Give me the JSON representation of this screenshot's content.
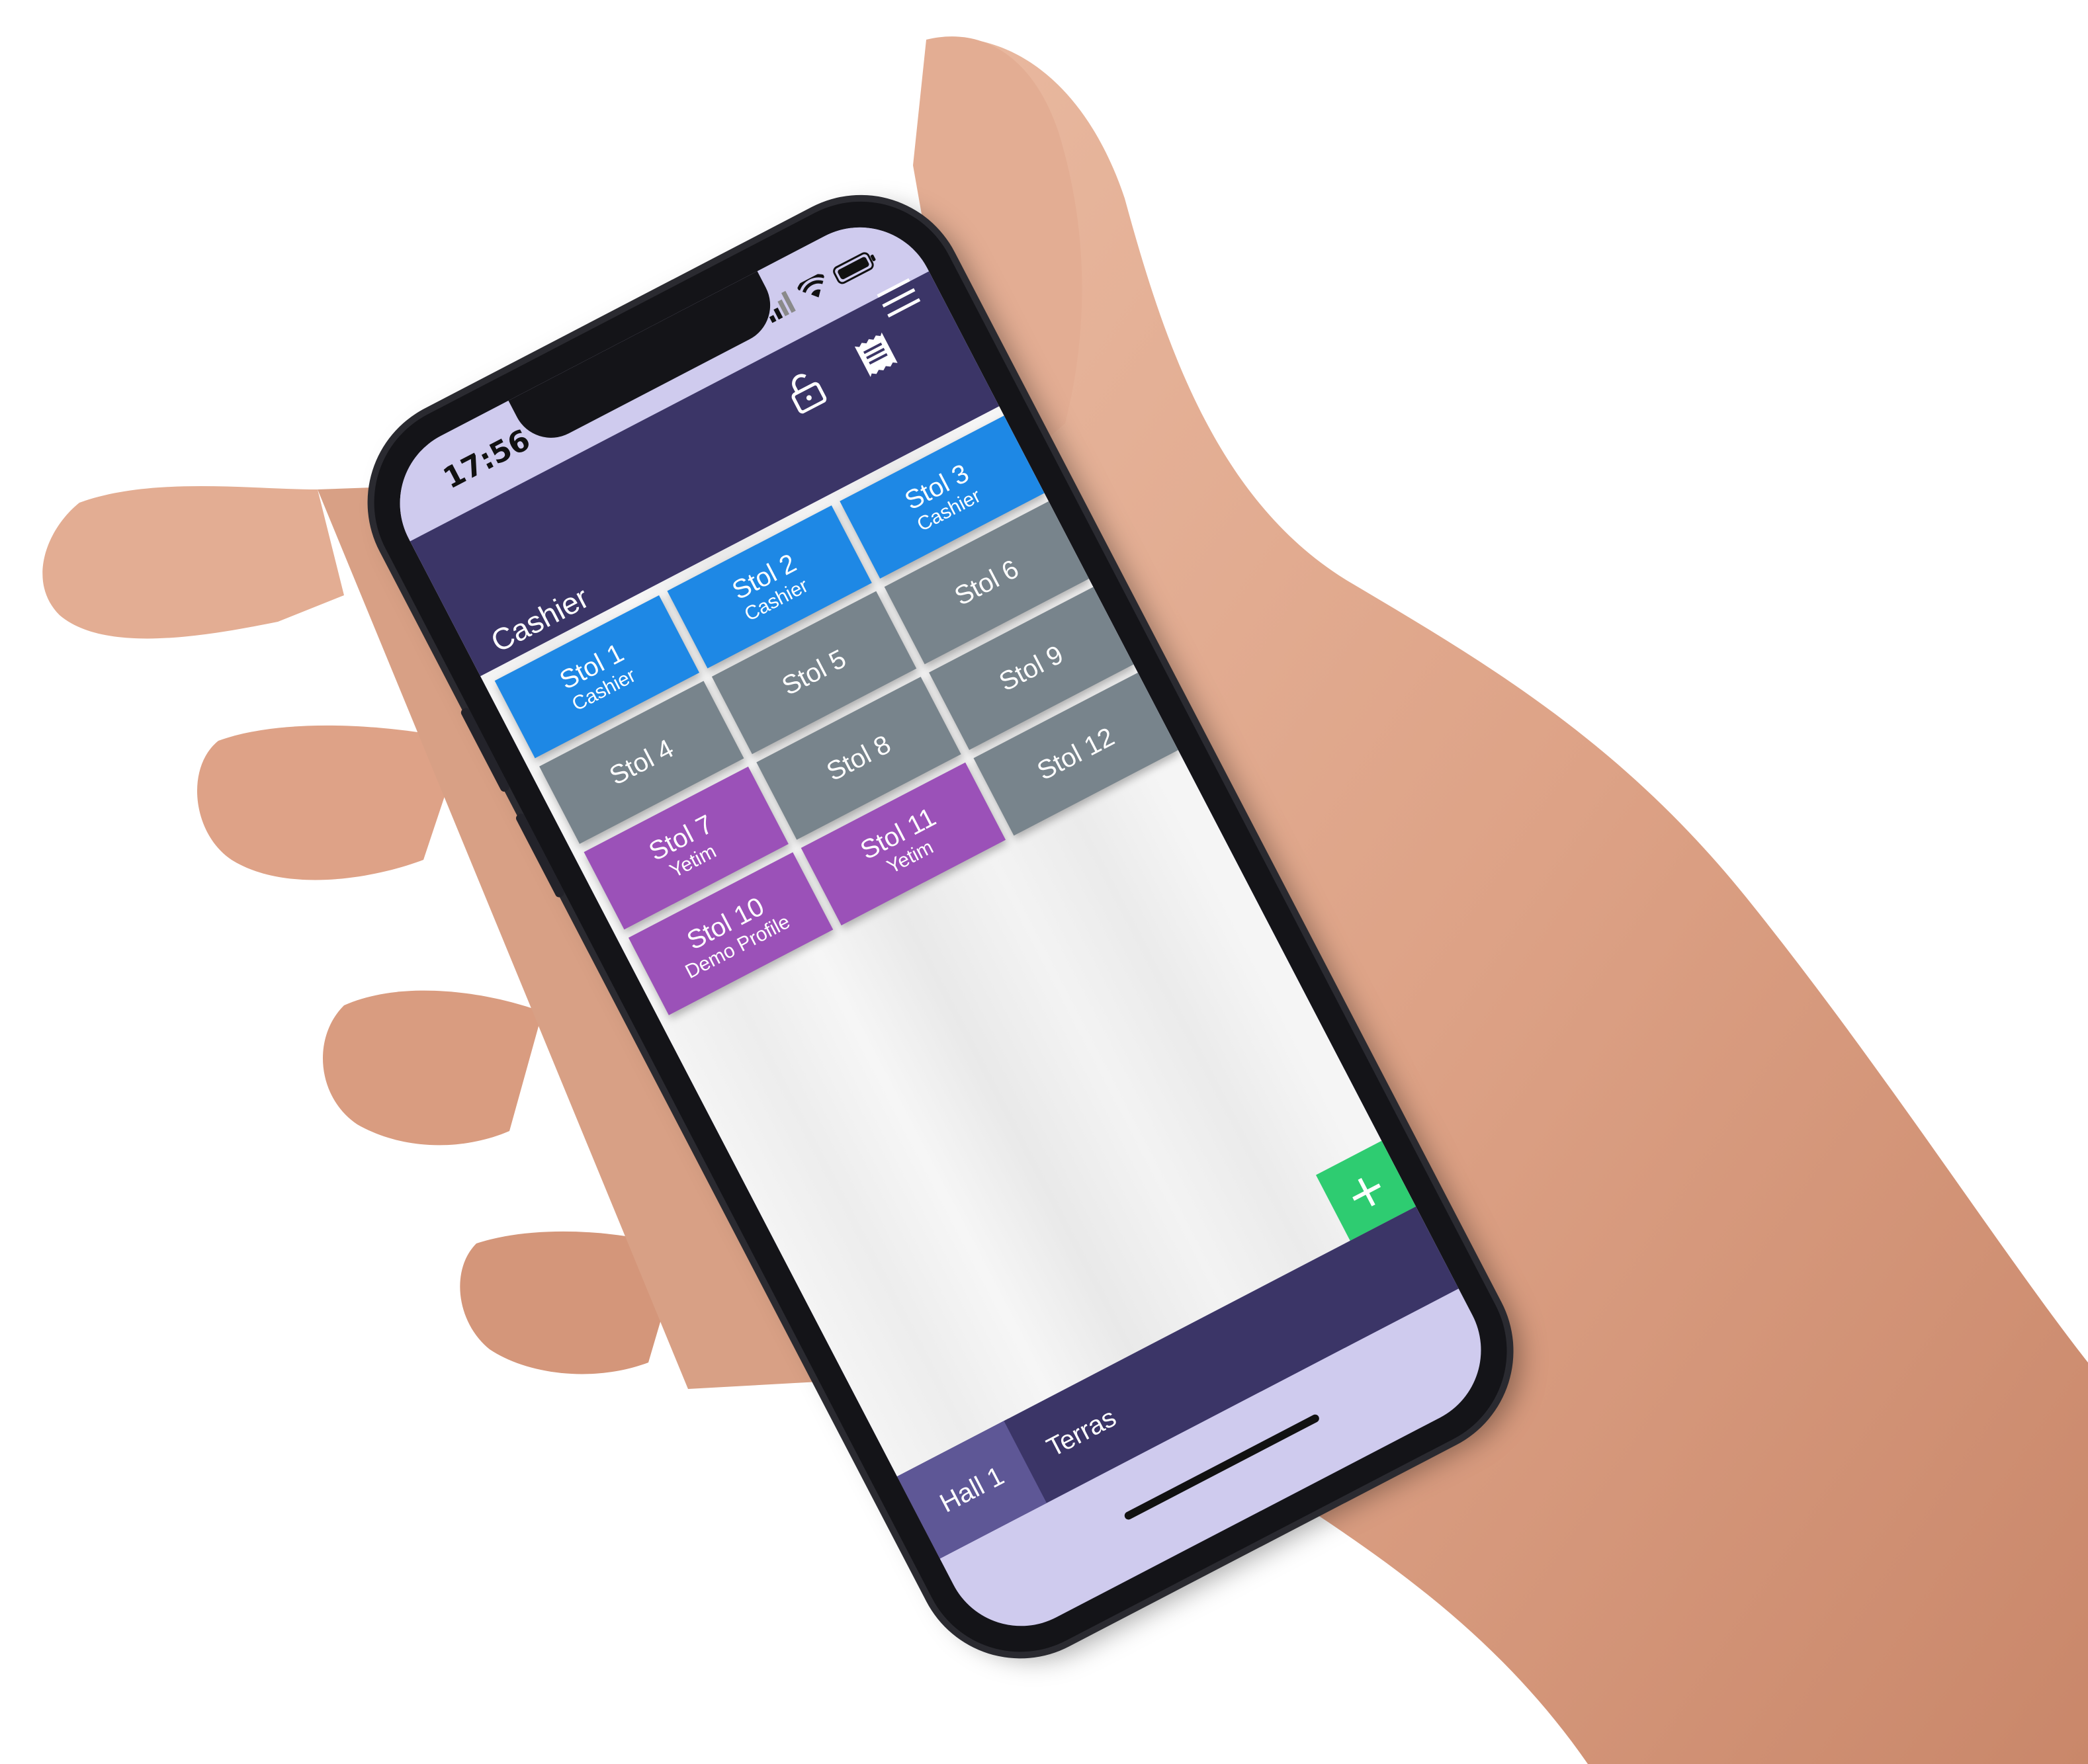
{
  "status_bar": {
    "time": "17:56"
  },
  "header": {
    "role_label": "Cashier"
  },
  "tables": [
    {
      "name": "Stol 1",
      "waiter": "Cashier",
      "color": "#1e88e5"
    },
    {
      "name": "Stol 2",
      "waiter": "Cashier",
      "color": "#1e88e5"
    },
    {
      "name": "Stol 3",
      "waiter": "Cashier",
      "color": "#1e88e5"
    },
    {
      "name": "Stol 4",
      "waiter": "",
      "color": "#78848c"
    },
    {
      "name": "Stol 5",
      "waiter": "",
      "color": "#78848c"
    },
    {
      "name": "Stol 6",
      "waiter": "",
      "color": "#78848c"
    },
    {
      "name": "Stol 7",
      "waiter": "Yetim",
      "color": "#9b51b8"
    },
    {
      "name": "Stol 8",
      "waiter": "",
      "color": "#78848c"
    },
    {
      "name": "Stol 9",
      "waiter": "",
      "color": "#78848c"
    },
    {
      "name": "Stol 10",
      "waiter": "Demo Profile",
      "color": "#9b51b8"
    },
    {
      "name": "Stol 11",
      "waiter": "Yetim",
      "color": "#9b51b8"
    },
    {
      "name": "Stol 12",
      "waiter": "",
      "color": "#78848c"
    }
  ],
  "halls": [
    {
      "label": "Hall 1",
      "active": true
    },
    {
      "label": "Terras",
      "active": false
    }
  ],
  "fab": {
    "label": "+"
  },
  "colors": {
    "header": "#3b3567",
    "status_bg": "#cfcbee",
    "occupied_cashier": "#1e88e5",
    "free": "#78848c",
    "occupied_other": "#9b51b8",
    "add": "#2ecc71"
  }
}
